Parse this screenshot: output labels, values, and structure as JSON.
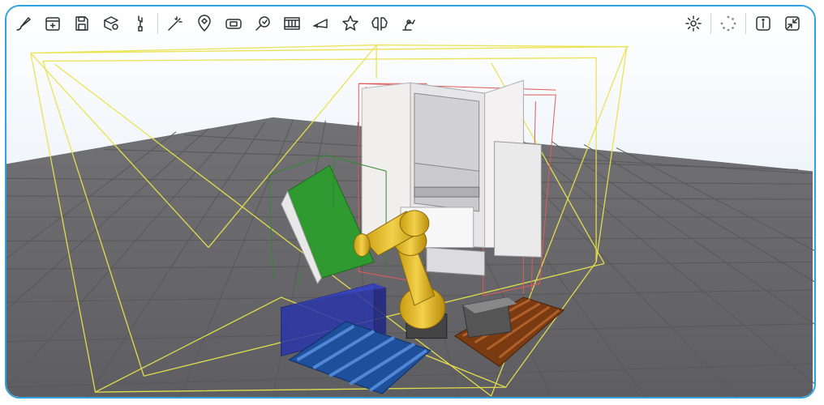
{
  "app": {
    "title": ""
  },
  "toolbar": {
    "left_tools": [
      "brush-icon",
      "add-file-icon",
      "save-icon",
      "object-settings-icon",
      "wrench-icon",
      "magic-wand-icon",
      "location-pin-icon",
      "teach-pendant-icon",
      "inspect-icon",
      "film-strip-icon",
      "horn-icon",
      "star-icon",
      "brain-icon",
      "robot-arm-icon"
    ],
    "right_tools": [
      "settings-icon",
      "loading-spinner-icon",
      "info-icon",
      "collapse-icon"
    ]
  },
  "scene": {
    "floor_color": "#6d6d70",
    "grid_color": "#585858",
    "sky_color": "#dbe7f3",
    "robot_color": "#e9c026",
    "bin_blue": "#2a35a8",
    "pallet_blue": "#1d4f9a",
    "pallet_brown": "#7a3a12",
    "panel_green": "#2f9a2f",
    "safety_zone_color": "#e9e24a",
    "cell_frame_color": "#e05a5a"
  }
}
